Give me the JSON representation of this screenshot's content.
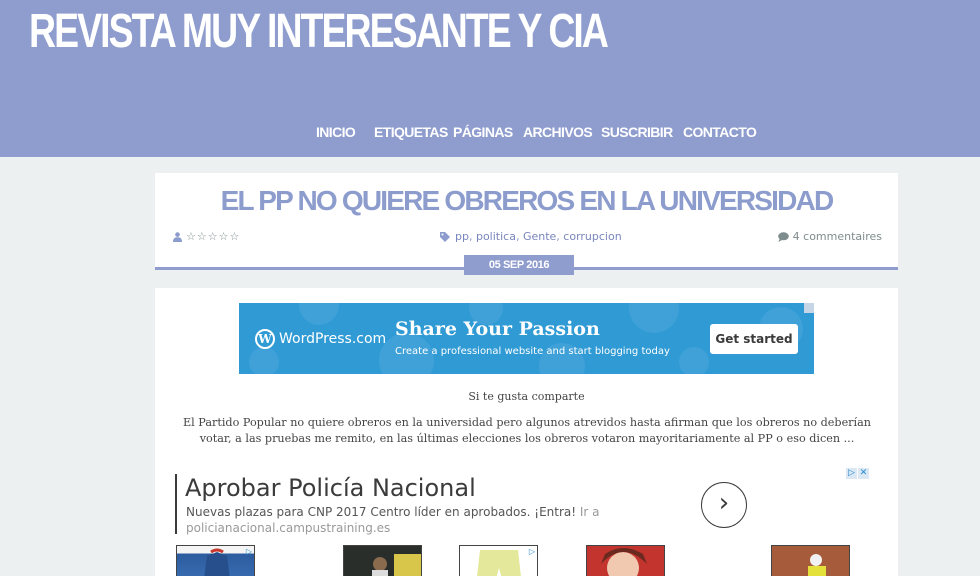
{
  "header": {
    "site_title": "REVISTA MUY INTERESANTE Y CIA",
    "nav": [
      "INICIO",
      "ETIQUETAS",
      "PÁGINAS",
      "ARCHIVOS",
      "SUSCRIBIR",
      "CONTACTO"
    ]
  },
  "post": {
    "title": "EL PP NO QUIERE OBREROS EN LA UNIVERSIDAD",
    "rating_stars": "☆☆☆☆☆",
    "tags": [
      "pp",
      "politica",
      "Gente",
      "corrupcion"
    ],
    "tag_separator": ",",
    "comments": "4 commentaires",
    "date": "05 SEP 2016"
  },
  "wp_ad": {
    "logo_text": "WordPress.com",
    "headline": "Share Your Passion",
    "subline": "Create a professional website and start blogging today",
    "button": "Get started"
  },
  "content": {
    "share_text": "Si te gusta comparte",
    "excerpt": "El Partido Popular no quiere obreros en la universidad pero algunos atrevidos hasta afirman que los obreros no deberían votar, a las pruebas me remito, en las últimas elecciones los obreros votaron mayoritariamente al PP o eso dicen ..."
  },
  "google_ad": {
    "title": "Aprobar Policía Nacional",
    "description": "Nuevas plazas para CNP 2017 Centro líder en aprobados. ¡Entra!",
    "more": "Ir a",
    "url": "policianacional.campustraining.es",
    "arrow": "›"
  },
  "colors": {
    "header_bg": "#8e9cce",
    "accent": "#8c9ccd",
    "wp_blue": "#2f9ad4"
  }
}
